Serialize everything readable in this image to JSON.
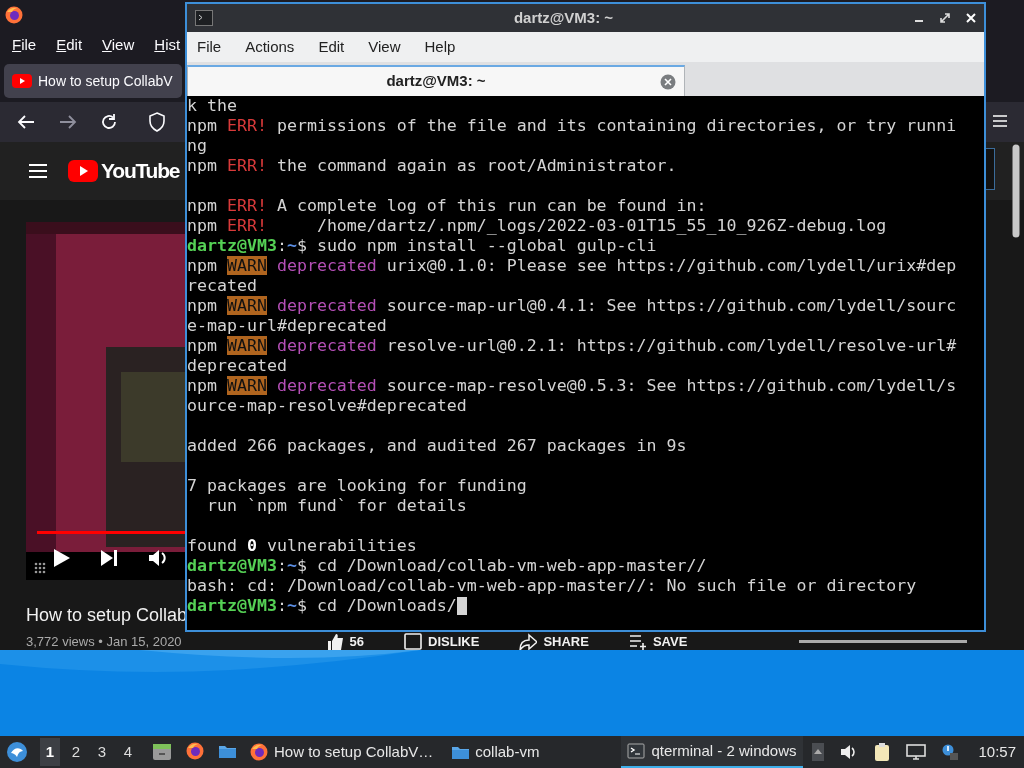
{
  "browser": {
    "menu": [
      "File",
      "Edit",
      "View",
      "Hist"
    ],
    "tab": {
      "title": "How to setup CollabV"
    },
    "site": {
      "logo_text": "YouTube"
    },
    "video": {
      "title": "How to setup Collab",
      "progress": {
        "level": 1
      },
      "views": "3,772 views • Jan 15, 2020",
      "actions": [
        {
          "kind": "like",
          "label": "56"
        },
        {
          "kind": "dislike",
          "label": "DISLIKE"
        },
        {
          "kind": "share",
          "label": "SHARE"
        },
        {
          "kind": "save",
          "label": "SAVE"
        }
      ]
    }
  },
  "terminal": {
    "title": "dartz@VM3: ~",
    "menu": [
      "File",
      "Actions",
      "Edit",
      "View",
      "Help"
    ],
    "tabs": [
      {
        "label": "dartz@VM3: ~",
        "selected": true
      }
    ],
    "lines": [
      {
        "segments": [
          {
            "kind": "plain",
            "text": "k the"
          }
        ]
      },
      {
        "segments": [
          {
            "kind": "plain",
            "text": "npm "
          },
          {
            "kind": "err",
            "text": "ERR!"
          },
          {
            "kind": "plain",
            "text": " permissions of the file and its containing directories, or try runni"
          }
        ]
      },
      {
        "segments": [
          {
            "kind": "plain",
            "text": "ng"
          }
        ]
      },
      {
        "segments": [
          {
            "kind": "plain",
            "text": "npm "
          },
          {
            "kind": "err",
            "text": "ERR!"
          },
          {
            "kind": "plain",
            "text": " the command again as root/Administrator."
          }
        ]
      },
      {
        "blank_before": true,
        "segments": [
          {
            "kind": "plain",
            "text": "npm "
          },
          {
            "kind": "err",
            "text": "ERR!"
          },
          {
            "kind": "plain",
            "text": " A complete log of this run can be found in:"
          }
        ]
      },
      {
        "segments": [
          {
            "kind": "plain",
            "text": "npm "
          },
          {
            "kind": "err",
            "text": "ERR!"
          },
          {
            "kind": "plain",
            "text": "     /home/dartz/.npm/_logs/2022-03-01T15_55_10_926Z-debug.log"
          }
        ]
      },
      {
        "segments": [
          {
            "kind": "user",
            "text": "dartz@VM3"
          },
          {
            "kind": "plain",
            "text": ":"
          },
          {
            "kind": "path",
            "text": "~"
          },
          {
            "kind": "plain",
            "text": "$ sudo npm install --global gulp-cli"
          }
        ]
      },
      {
        "segments": [
          {
            "kind": "plain",
            "text": "npm "
          },
          {
            "kind": "warn",
            "text": "WARN"
          },
          {
            "kind": "dep",
            "text": " deprecated"
          },
          {
            "kind": "plain",
            "text": " urix@0.1.0: Please see https://github.com/lydell/urix#dep"
          }
        ]
      },
      {
        "segments": [
          {
            "kind": "plain",
            "text": "recated"
          }
        ]
      },
      {
        "segments": [
          {
            "kind": "plain",
            "text": "npm "
          },
          {
            "kind": "warn",
            "text": "WARN"
          },
          {
            "kind": "dep",
            "text": " deprecated"
          },
          {
            "kind": "plain",
            "text": " source-map-url@0.4.1: See https://github.com/lydell/sourc"
          }
        ]
      },
      {
        "segments": [
          {
            "kind": "plain",
            "text": "e-map-url#deprecated"
          }
        ]
      },
      {
        "segments": [
          {
            "kind": "plain",
            "text": "npm "
          },
          {
            "kind": "warn",
            "text": "WARN"
          },
          {
            "kind": "dep",
            "text": " deprecated"
          },
          {
            "kind": "plain",
            "text": " resolve-url@0.2.1: https://github.com/lydell/resolve-url#"
          }
        ]
      },
      {
        "segments": [
          {
            "kind": "plain",
            "text": "deprecated"
          }
        ]
      },
      {
        "segments": [
          {
            "kind": "plain",
            "text": "npm "
          },
          {
            "kind": "warn",
            "text": "WARN"
          },
          {
            "kind": "dep",
            "text": " deprecated"
          },
          {
            "kind": "plain",
            "text": " source-map-resolve@0.5.3: See https://github.com/lydell/s"
          }
        ]
      },
      {
        "segments": [
          {
            "kind": "plain",
            "text": "ource-map-resolve#deprecated"
          }
        ]
      },
      {
        "blank_before": true,
        "segments": [
          {
            "kind": "plain",
            "text": "added 266 packages, and audited 267 packages in 9s"
          }
        ]
      },
      {
        "blank_before": true,
        "segments": [
          {
            "kind": "plain",
            "text": "7 packages are looking for funding"
          }
        ]
      },
      {
        "segments": [
          {
            "kind": "plain",
            "text": "  run `npm fund` for details"
          }
        ]
      },
      {
        "blank_before": true,
        "segments": [
          {
            "kind": "plain",
            "text": "found "
          },
          {
            "kind": "bold",
            "text": "0"
          },
          {
            "kind": "plain",
            "text": " vulnerabilities"
          }
        ]
      },
      {
        "segments": [
          {
            "kind": "user",
            "text": "dartz@VM3"
          },
          {
            "kind": "plain",
            "text": ":"
          },
          {
            "kind": "path",
            "text": "~"
          },
          {
            "kind": "plain",
            "text": "$ cd /Download/collab-vm-web-app-master//"
          }
        ]
      },
      {
        "segments": [
          {
            "kind": "plain",
            "text": "bash: cd: /Download/collab-vm-web-app-master//: No such file or directory"
          }
        ]
      },
      {
        "segments": [
          {
            "kind": "user",
            "text": "dartz@VM3"
          },
          {
            "kind": "plain",
            "text": ":"
          },
          {
            "kind": "path",
            "text": "~"
          },
          {
            "kind": "plain",
            "text": "$ cd /Downloads/"
          }
        ],
        "cursor": true
      }
    ]
  },
  "taskbar": {
    "workspaces": [
      {
        "label": "1",
        "selected": true
      },
      {
        "label": "2",
        "selected": false
      },
      {
        "label": "3",
        "selected": false
      },
      {
        "label": "4",
        "selected": false
      }
    ],
    "tasks": [
      {
        "kind": "browser",
        "label": "How to setup CollabV…",
        "selected": false
      },
      {
        "kind": "folder",
        "label": "collab-vm",
        "selected": false
      },
      {
        "kind": "terminal",
        "label": "qterminal - 2 windows",
        "selected": true
      }
    ],
    "clock": "10:57"
  }
}
